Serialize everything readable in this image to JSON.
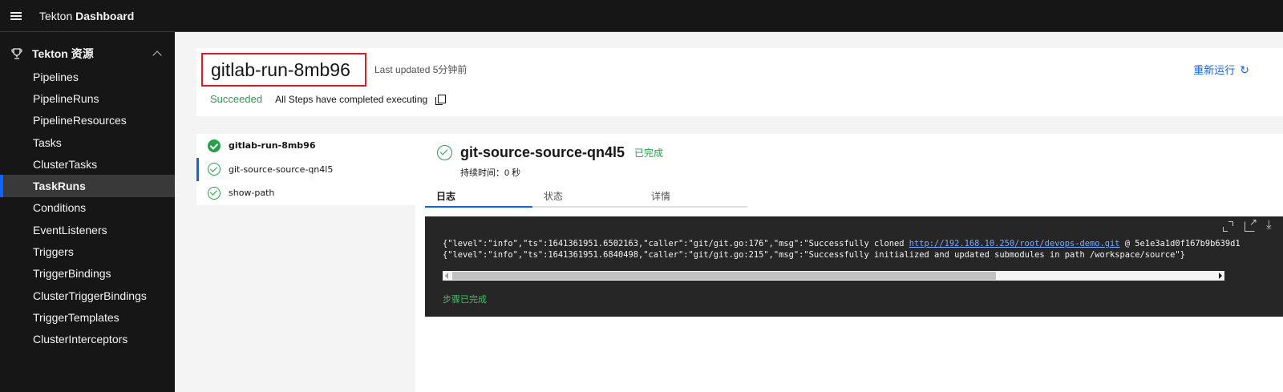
{
  "header": {
    "brand_prefix": "Tekton",
    "brand_name": "Dashboard"
  },
  "sidebar": {
    "section_label": "Tekton 资源",
    "items": [
      {
        "label": "Pipelines",
        "active": false
      },
      {
        "label": "PipelineRuns",
        "active": false
      },
      {
        "label": "PipelineResources",
        "active": false
      },
      {
        "label": "Tasks",
        "active": false
      },
      {
        "label": "ClusterTasks",
        "active": false
      },
      {
        "label": "TaskRuns",
        "active": true
      },
      {
        "label": "Conditions",
        "active": false
      },
      {
        "label": "EventListeners",
        "active": false
      },
      {
        "label": "Triggers",
        "active": false
      },
      {
        "label": "TriggerBindings",
        "active": false
      },
      {
        "label": "ClusterTriggerBindings",
        "active": false
      },
      {
        "label": "TriggerTemplates",
        "active": false
      },
      {
        "label": "ClusterInterceptors",
        "active": false
      }
    ]
  },
  "run": {
    "title": "gitlab-run-8mb96",
    "last_updated": "Last updated 5分钟前",
    "rerun_label": "重新运行",
    "status": "Succeeded",
    "status_message": "All Steps have completed executing"
  },
  "task_tree": [
    {
      "label": "gitlab-run-8mb96",
      "kind": "task"
    },
    {
      "label": "git-source-source-qn4l5",
      "kind": "step",
      "selected": true
    },
    {
      "label": "show-path",
      "kind": "step"
    }
  ],
  "step": {
    "name": "git-source-source-qn4l5",
    "badge": "已完成",
    "duration": "持续时间：0 秒",
    "tabs": [
      "日志",
      "状态",
      "详情"
    ],
    "active_tab": "日志"
  },
  "log": {
    "line1_prefix": "{\"level\":\"info\",\"ts\":1641361951.6502163,\"caller\":\"git/git.go:176\",\"msg\":\"Successfully cloned ",
    "line1_link": "http://192.168.10.250/root/devops-demo.git",
    "line1_suffix": " @ 5e1e3a1d0f167b9b639d1",
    "line2": "{\"level\":\"info\",\"ts\":1641361951.6840498,\"caller\":\"git/git.go:215\",\"msg\":\"Successfully initialized and updated submodules in path /workspace/source\"}",
    "footer": "步骤已完成"
  },
  "colors": {
    "accent": "#0f62fe",
    "success": "#24a148",
    "highlight_border": "#da1e28"
  }
}
